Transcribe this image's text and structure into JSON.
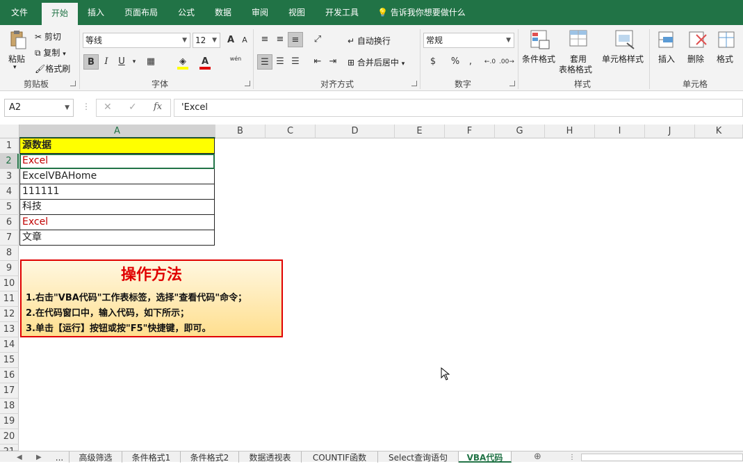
{
  "ribbon_tabs": [
    "文件",
    "开始",
    "插入",
    "页面布局",
    "公式",
    "数据",
    "审阅",
    "视图",
    "开发工具"
  ],
  "active_tab": "开始",
  "tell_me": "告诉我你想要做什么",
  "clipboard": {
    "paste": "粘贴",
    "cut": "剪切",
    "copy": "复制",
    "format_painter": "格式刷",
    "label": "剪贴板"
  },
  "font": {
    "name": "等线",
    "size": "12",
    "label": "字体",
    "bold": "B",
    "italic": "I",
    "underline": "U",
    "grow": "A",
    "shrink": "A",
    "phonetic": "wén",
    "font_color_letter": "A"
  },
  "alignment": {
    "wrap": "自动换行",
    "merge": "合并后居中",
    "label": "对齐方式"
  },
  "number": {
    "format": "常规",
    "percent": "%",
    "comma": ",",
    "label": "数字"
  },
  "styles": {
    "conditional": "条件格式",
    "table_1": "套用",
    "table_2": "表格格式",
    "cell_styles": "单元格样式",
    "label": "样式"
  },
  "cells": {
    "insert": "插入",
    "delete": "删除",
    "format": "格式",
    "label": "单元格"
  },
  "name_box": "A2",
  "fx": "fx",
  "formula": "'Excel",
  "columns": [
    "A",
    "B",
    "C",
    "D",
    "E",
    "F",
    "G",
    "H",
    "I",
    "J",
    "K"
  ],
  "rows": [
    "1",
    "2",
    "3",
    "4",
    "5",
    "6",
    "7",
    "8",
    "9",
    "10",
    "11",
    "12",
    "13",
    "14",
    "15",
    "16",
    "17",
    "18",
    "19",
    "20",
    "21"
  ],
  "cells_data": [
    "源数据",
    "Excel",
    "ExcelVBAHome",
    "111111",
    "科技",
    "Excel",
    "文章"
  ],
  "note": {
    "title": "操作方法",
    "lines": [
      "1.右击\"VBA代码\"工作表标签，选择\"查看代码\"命令；",
      "2.在代码窗口中，输入代码，如下所示；",
      "3.单击【运行】按钮或按\"F5\"快捷键，即可。"
    ]
  },
  "sheet_tabs": [
    "...",
    "高级筛选",
    "条件格式1",
    "条件格式2",
    "数据透视表",
    "COUNTIF函数",
    "Select查询语句",
    "VBA代码"
  ],
  "active_sheet": "VBA代码",
  "colors": {
    "accent": "#217346",
    "note_border": "#e00000",
    "red_text": "#c00000",
    "header_fill": "#ffff00"
  }
}
